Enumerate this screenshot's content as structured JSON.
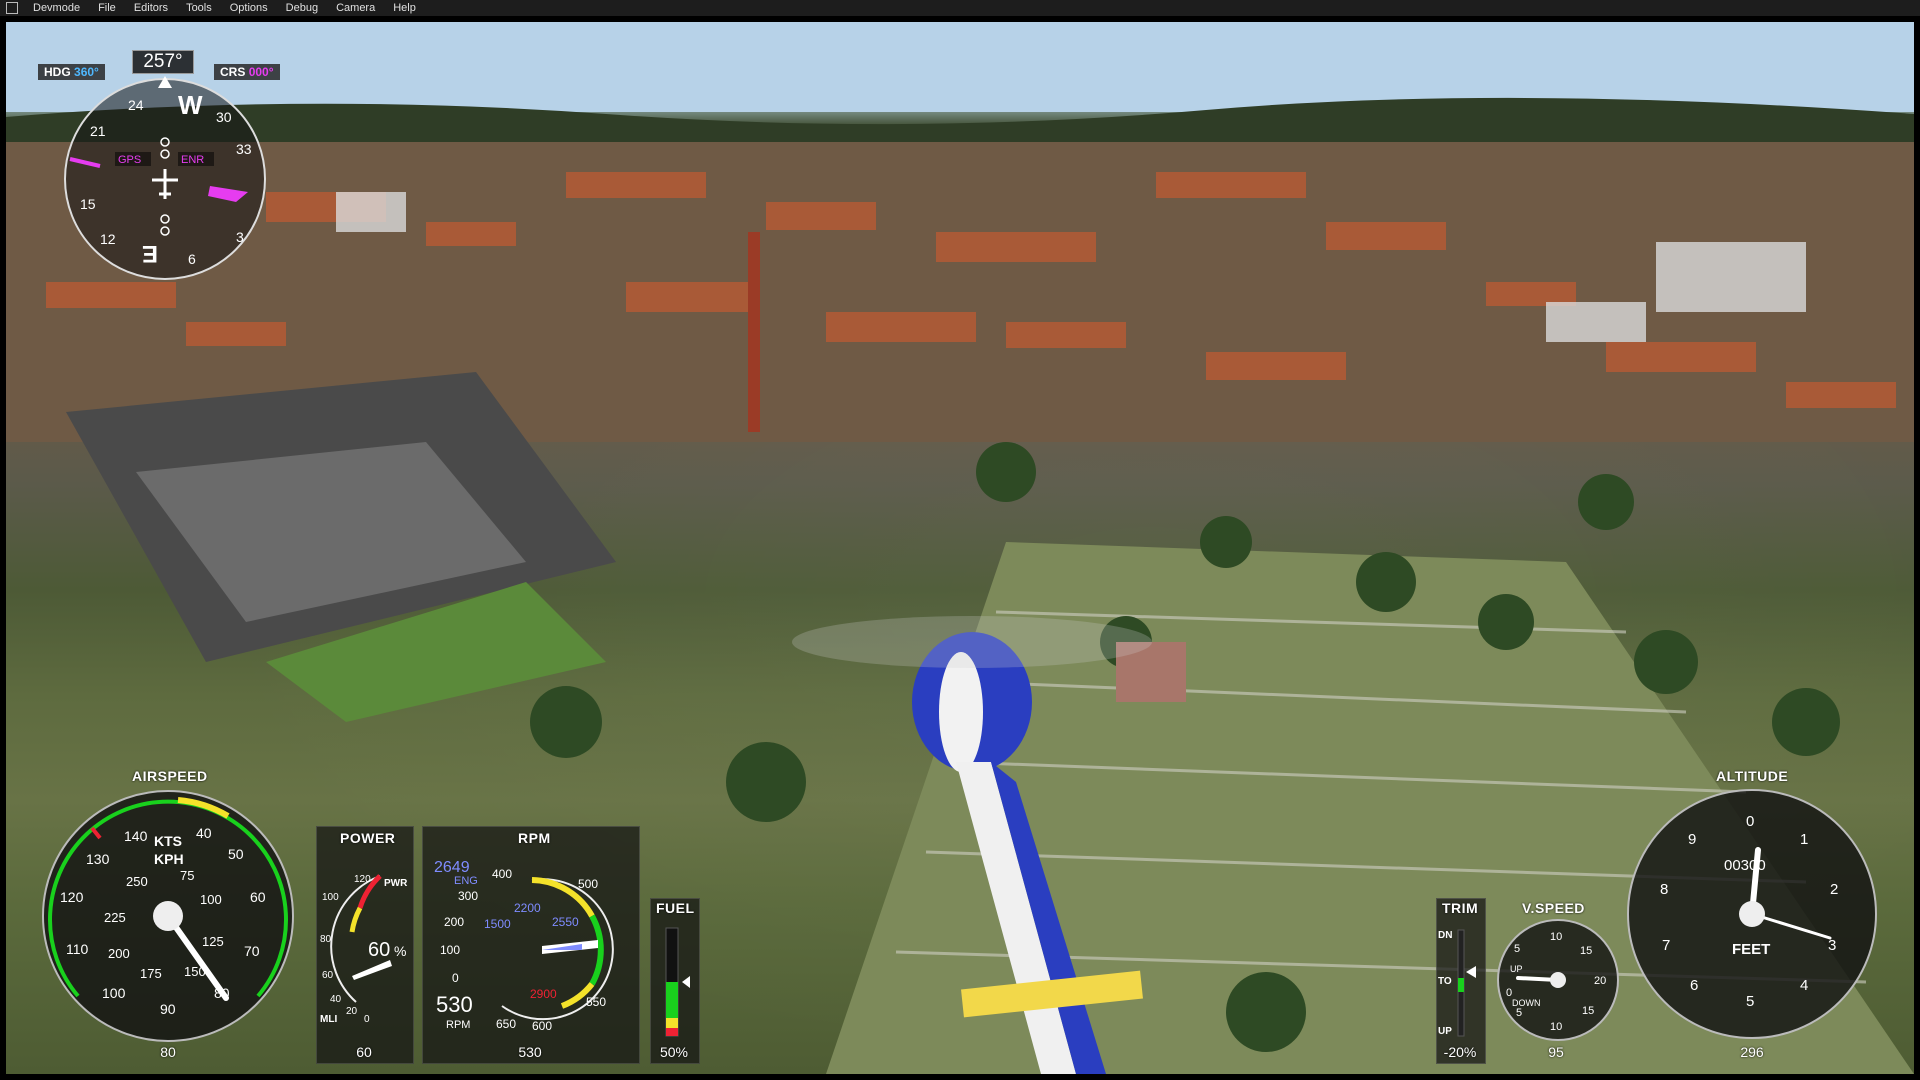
{
  "menu": {
    "items": [
      "Devmode",
      "File",
      "Editors",
      "Tools",
      "Options",
      "Debug",
      "Camera",
      "Help"
    ]
  },
  "hsi": {
    "heading_readout": "257°",
    "hdg_label": "HDG",
    "hdg_value": "360°",
    "crs_label": "CRS",
    "crs_value": "000°",
    "gps_tag": "GPS",
    "enr_tag": "ENR",
    "cardinals": [
      "W",
      "E"
    ],
    "numbers": [
      "24",
      "30",
      "33",
      "21",
      "15",
      "12",
      "6",
      "3"
    ],
    "colors": {
      "course": "#e63cf0",
      "gps": "#e63cf0"
    }
  },
  "airspeed": {
    "title": "AIRSPEED",
    "units_kts": "KTS",
    "units_kph": "KPH",
    "outer_labels": [
      "140",
      "40",
      "50",
      "60",
      "70",
      "80",
      "90",
      "100",
      "110",
      "120",
      "130"
    ],
    "inner_labels": [
      "250",
      "75",
      "100",
      "125",
      "150",
      "175",
      "200",
      "225"
    ],
    "footer": "80",
    "needle_value_kts": 80
  },
  "power": {
    "title": "POWER",
    "pwr_label": "PWR",
    "mli_label": "MLI",
    "labels": [
      "120",
      "100",
      "80",
      "60",
      "40",
      "20",
      "0"
    ],
    "percent": "60",
    "percent_sign": "%",
    "footer": "60"
  },
  "rpm": {
    "title": "RPM",
    "eng_value": "2649",
    "eng_label": "ENG",
    "rotor_value": "530",
    "rotor_label": "RPM",
    "outer_labels": [
      "400",
      "300",
      "200",
      "100",
      "0",
      "500",
      "550",
      "600",
      "650"
    ],
    "inner_labels": [
      "2200",
      "1500",
      "2550",
      "2900"
    ],
    "footer": "530"
  },
  "fuel": {
    "title": "FUEL",
    "footer": "50%",
    "level": 0.5
  },
  "trim": {
    "title": "TRIM",
    "dn_label": "DN",
    "to_label": "TO",
    "up_label": "UP",
    "footer": "-20%"
  },
  "vspeed": {
    "title": "V.SPEED",
    "labels": [
      "10",
      "15",
      "20",
      "15",
      "10",
      "5",
      "0",
      "5"
    ],
    "up_label": "UP",
    "down_label": "DOWN",
    "footer": "95"
  },
  "altitude": {
    "title": "ALTITUDE",
    "labels": [
      "0",
      "1",
      "2",
      "3",
      "4",
      "5",
      "6",
      "7",
      "8",
      "9"
    ],
    "drum": "00300",
    "units": "FEET",
    "footer": "296"
  }
}
